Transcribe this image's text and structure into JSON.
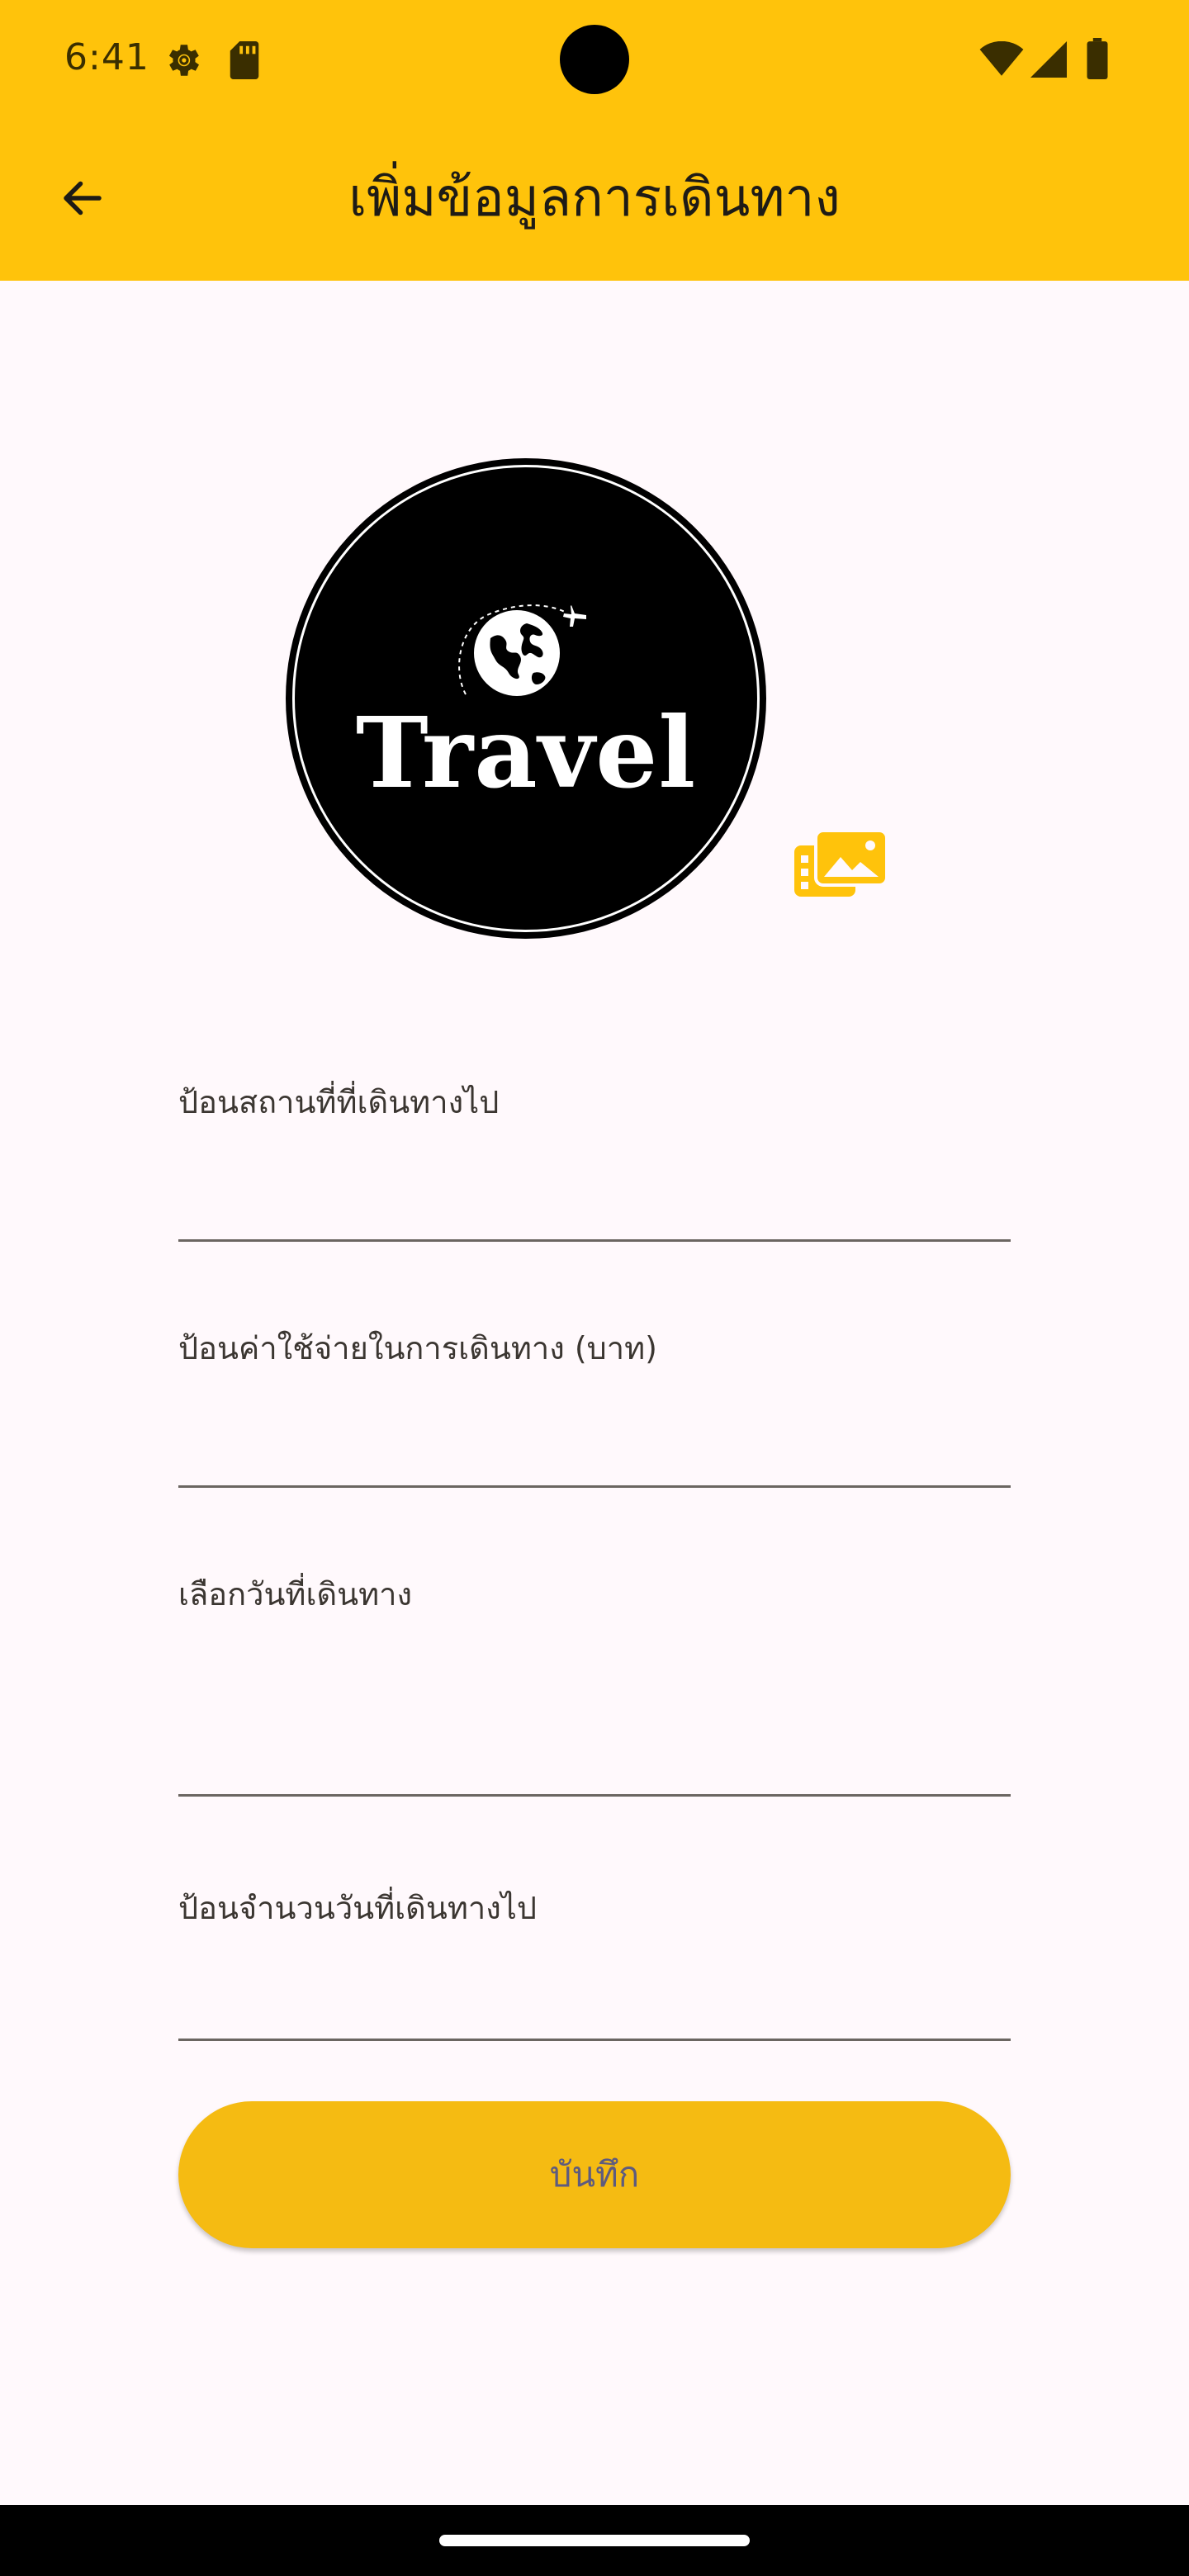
{
  "status_bar": {
    "time": "6:41",
    "icons": [
      "settings-gear-icon",
      "sd-card-icon",
      "wifi-icon",
      "cell-signal-icon",
      "battery-icon"
    ]
  },
  "app_bar": {
    "title": "เพิ่มข้อมูลการเดินทาง",
    "back_icon": "arrow-back-icon"
  },
  "logo": {
    "text": "Travel",
    "icon": "globe-airplane-icon"
  },
  "gallery_icon": "photo-library-icon",
  "form": {
    "destination": {
      "label": "ป้อนสถานที่ที่เดินทางไป",
      "value": ""
    },
    "cost": {
      "label": "ป้อนค่าใช้จ่ายในการเดินทาง (บาท)",
      "value": ""
    },
    "date": {
      "label": "เลือกวันที่เดินทาง",
      "value": ""
    },
    "days": {
      "label": "ป้อนจำนวนวันที่เดินทางไป",
      "value": ""
    }
  },
  "save_button": {
    "label": "บันทึก"
  },
  "colors": {
    "app_bar": "#FFC30B",
    "accent_icon": "#FFC30B",
    "button": "#F5BB12",
    "button_text": "#5E5B7E",
    "background": "#FFF9FC"
  }
}
